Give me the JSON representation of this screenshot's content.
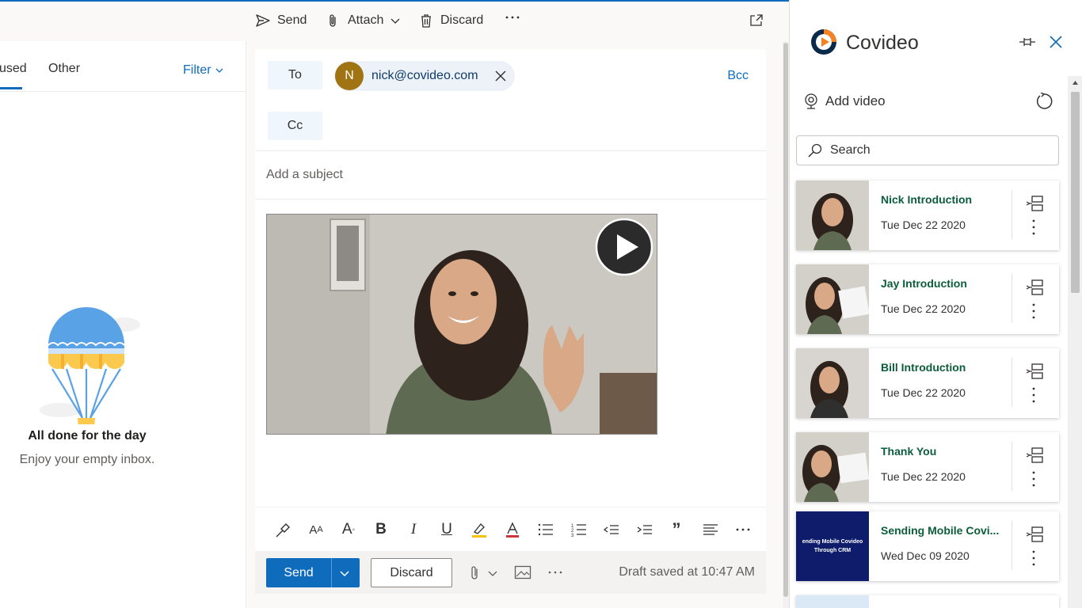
{
  "toolbar": {
    "send_label": "Send",
    "attach_label": "Attach",
    "discard_label": "Discard",
    "more_icon": "ellipsis-icon",
    "popout_icon": "popout-icon"
  },
  "inbox": {
    "tab_focused": "used",
    "tab_other": "Other",
    "filter_label": "Filter",
    "empty_title": "All done for the day",
    "empty_subtitle": "Enjoy your empty inbox."
  },
  "compose": {
    "to_label": "To",
    "cc_label": "Cc",
    "bcc_label": "Bcc",
    "recipient": {
      "initial": "N",
      "email": "nick@covideo.com",
      "avatar_color": "#a07412"
    },
    "subject_placeholder": "Add a subject",
    "send_label": "Send",
    "discard_label": "Discard",
    "draft_status": "Draft saved at 10:47 AM",
    "accent_color": "#0f6cbd"
  },
  "covideo": {
    "title": "Covideo",
    "add_video_label": "Add video",
    "search_placeholder": "Search",
    "videos": [
      {
        "title": "Nick Introduction",
        "date": "Tue Dec 22 2020"
      },
      {
        "title": "Jay Introduction",
        "date": "Tue Dec 22 2020"
      },
      {
        "title": "Bill Introduction",
        "date": "Tue Dec 22 2020"
      },
      {
        "title": "Thank You",
        "date": "Tue Dec 22 2020"
      },
      {
        "title": "Sending Mobile Covi...",
        "date": "Wed Dec 09 2020",
        "thumb_text": "ending Mobile Covideo Through CRM"
      }
    ],
    "title_color": "#0b5d3b"
  }
}
